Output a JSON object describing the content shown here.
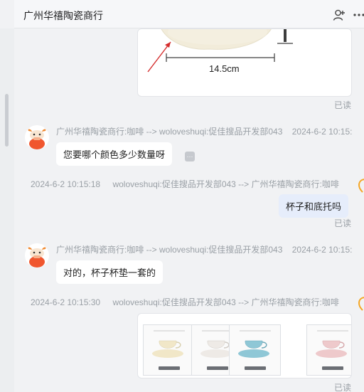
{
  "header": {
    "title": "广州华禧陶瓷商行"
  },
  "image_top": {
    "dimension_label": "14.5cm",
    "read_status": "已读"
  },
  "messages": [
    {
      "meta_sender": "广州华禧陶瓷商行:咖啡 --> woloveshuqi:促佳搜品开发部043",
      "meta_time": "2024-6-2 10:15:",
      "text": "您要哪个颜色多少数量呀"
    },
    {
      "meta_time": "2024-6-2 10:15:18",
      "meta_sender": "woloveshuqi:促佳搜品开发部043 --> 广州华禧陶瓷商行:咖啡",
      "text": "杯子和底托吗",
      "read_status": "已读"
    },
    {
      "meta_sender": "广州华禧陶瓷商行:咖啡 --> woloveshuqi:促佳搜品开发部043",
      "meta_time": "2024-6-2 10:15:",
      "text": "对的，杯子杯垫一套的"
    },
    {
      "meta_time": "2024-6-2 10:15:30",
      "meta_sender": "woloveshuqi:促佳搜品开发部043 --> 广州华禧陶瓷商行:咖啡",
      "read_status": "已读"
    }
  ],
  "products": [
    {
      "color": "#f1e7c8"
    },
    {
      "color": "#eeeae6"
    },
    {
      "color": "#8fc7d6"
    },
    {
      "color": "#eec9cb"
    }
  ],
  "icons": {
    "add_contact": "person-add-icon",
    "more": "ellipsis-icon",
    "curl": "orange-curl-icon"
  },
  "colors": {
    "accent": "#f5a623",
    "outgoing_bubble": "#e6edfb",
    "meta_text": "#9aa0a6"
  }
}
